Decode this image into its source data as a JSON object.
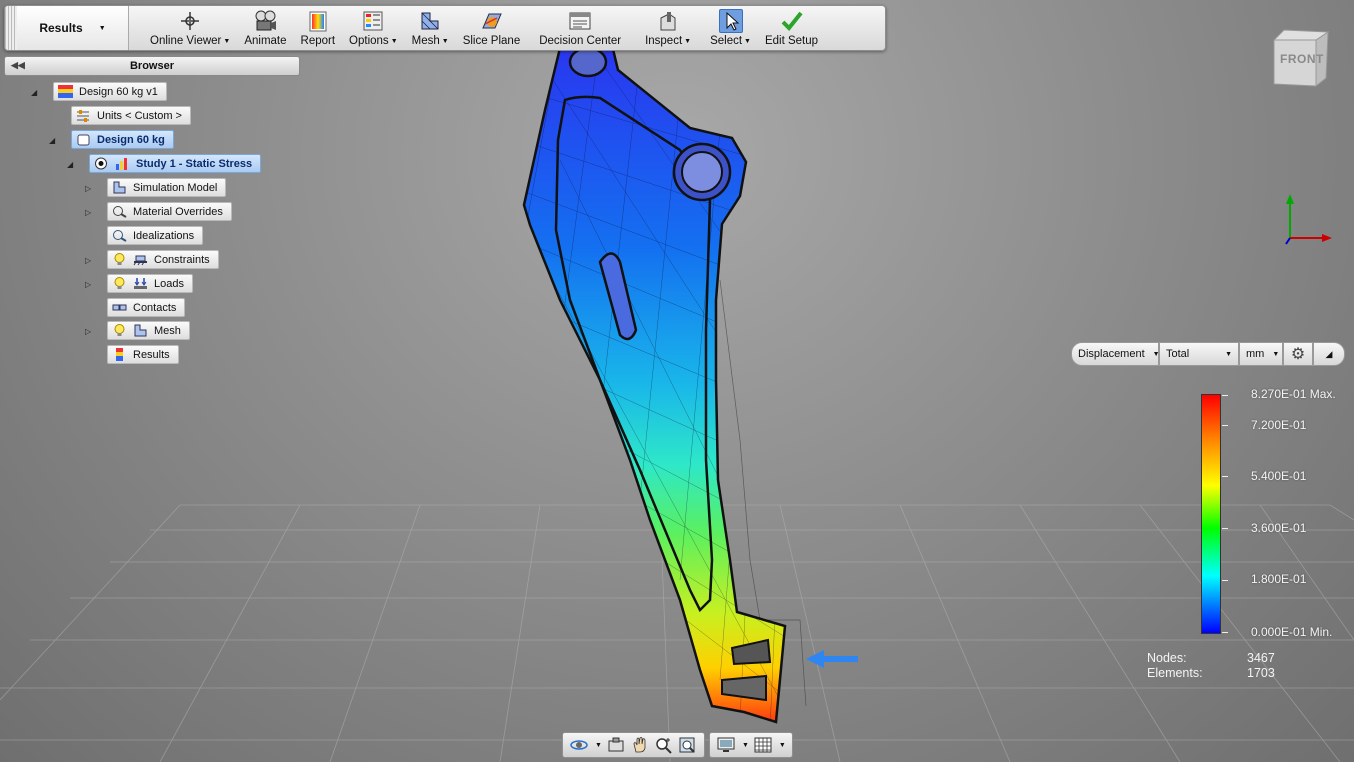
{
  "ribbon": {
    "tab_label": "Results",
    "buttons": [
      {
        "label": "Online Viewer",
        "dropdown": true,
        "icon": "online-viewer-icon"
      },
      {
        "label": "Animate",
        "dropdown": false,
        "icon": "animate-icon"
      },
      {
        "label": "Report",
        "dropdown": false,
        "icon": "report-icon"
      },
      {
        "label": "Options",
        "dropdown": true,
        "icon": "options-icon"
      },
      {
        "label": "Mesh",
        "dropdown": true,
        "icon": "mesh-icon"
      },
      {
        "label": "Slice Plane",
        "dropdown": false,
        "icon": "slice-plane-icon"
      },
      {
        "label": "Decision Center",
        "dropdown": false,
        "icon": "decision-center-icon"
      },
      {
        "label": "Inspect",
        "dropdown": true,
        "icon": "inspect-icon"
      },
      {
        "label": "Select",
        "dropdown": true,
        "icon": "select-cursor-icon"
      },
      {
        "label": "Edit Setup",
        "dropdown": false,
        "icon": "checkmark-icon"
      }
    ]
  },
  "browser": {
    "title": "Browser",
    "tree": {
      "design": "Design 60 kg v1",
      "units": "Units < Custom >",
      "component": "Design 60 kg",
      "study": "Study 1 - Static Stress",
      "items": {
        "simulation_model": "Simulation Model",
        "material_overrides": "Material Overrides",
        "idealizations": "Idealizations",
        "constraints": "Constraints",
        "loads": "Loads",
        "contacts": "Contacts",
        "mesh": "Mesh",
        "results": "Results"
      }
    }
  },
  "viewcube": {
    "face": "FRONT"
  },
  "legend": {
    "result_type": "Displacement",
    "component": "Total",
    "unit": "mm",
    "max_label": "8.270E-01 Max.",
    "min_label": "0.000E-01 Min.",
    "ticks": [
      "7.200E-01",
      "5.400E-01",
      "3.600E-01",
      "1.800E-01"
    ],
    "colors": [
      "#ff0000",
      "#ffff00",
      "#00ff00",
      "#00ffff",
      "#0000ff"
    ]
  },
  "mesh_stats": {
    "nodes_label": "Nodes:",
    "nodes_value": "3467",
    "elements_label": "Elements:",
    "elements_value": "1703"
  }
}
